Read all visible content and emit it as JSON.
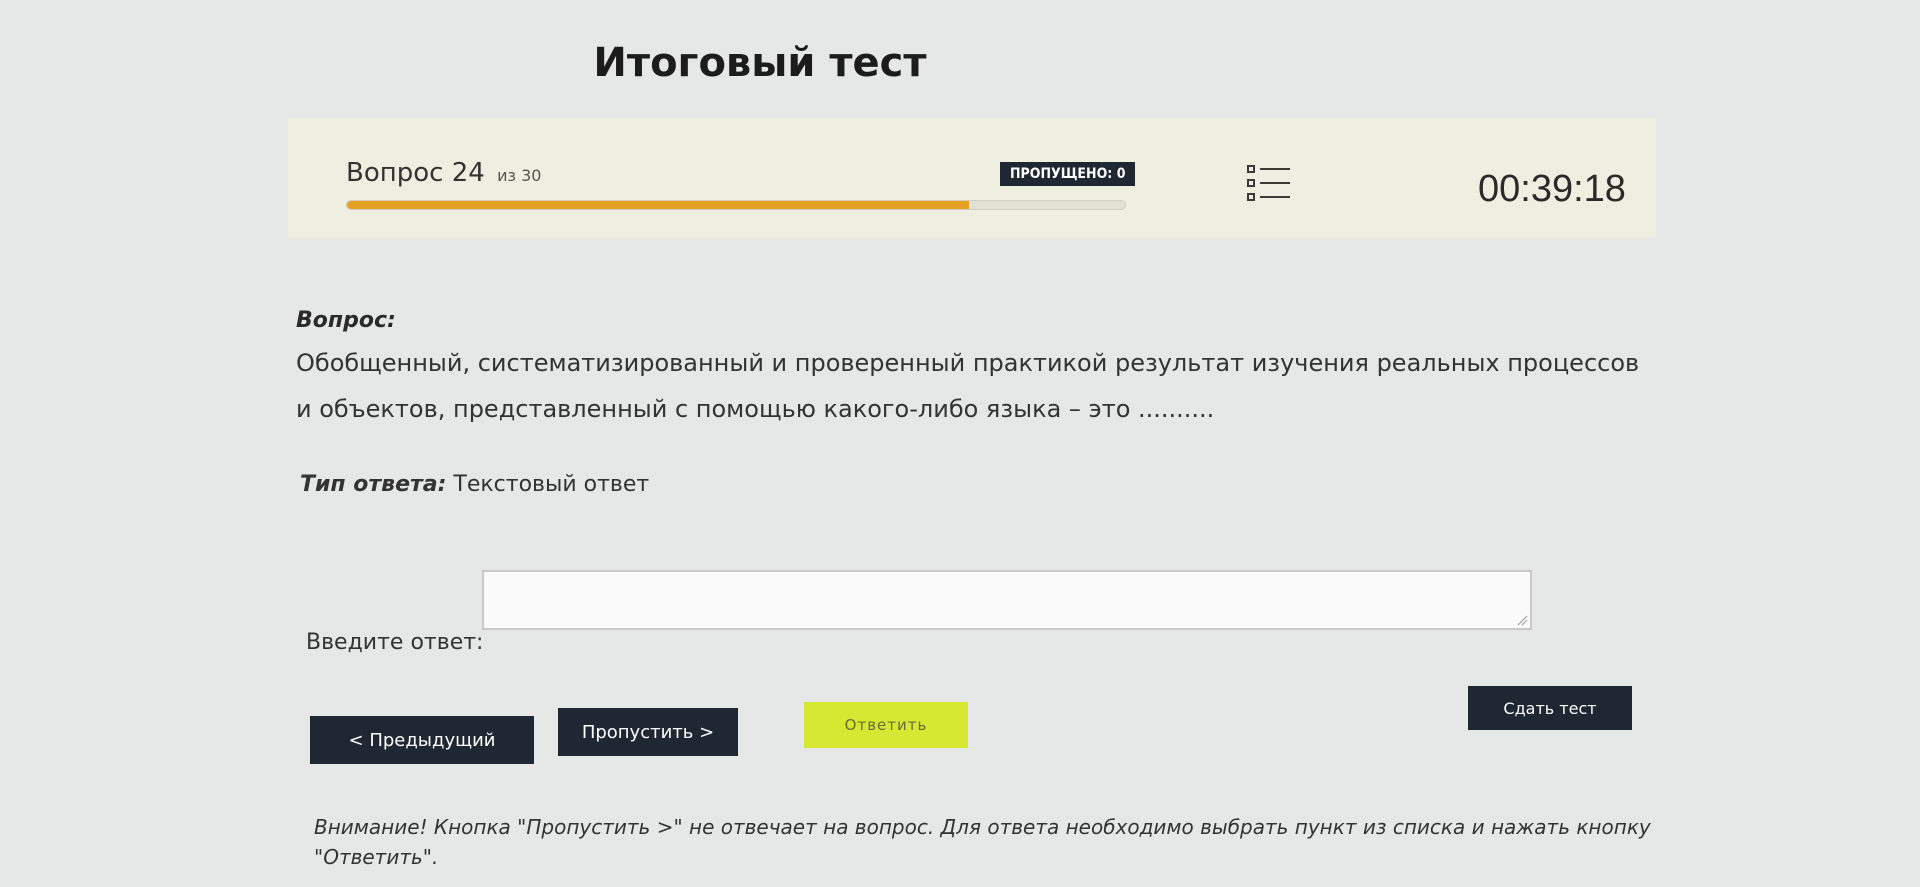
{
  "header": {
    "title": "Итоговый тест"
  },
  "status": {
    "question_label": "Вопрос 24",
    "question_total": "из 30",
    "progress": 0.8,
    "skipped_label": "ПРОПУЩЕНО: 0",
    "timer": "00:39:18"
  },
  "question": {
    "label": "Вопрос:",
    "text": "Обобщенный, систематизированный и проверенный практикой результат изучения реальных процессов и объектов, представленный с помощью какого-либо языка – это ..........",
    "answer_type_key": "Тип ответа:",
    "answer_type_value": "Текстовый ответ"
  },
  "answer": {
    "input_label": "Введите ответ:",
    "value": ""
  },
  "buttons": {
    "prev": "< Предыдущий",
    "skip": "Пропустить >",
    "answer": "Ответить",
    "submit": "Сдать тест"
  },
  "warning": "Внимание! Кнопка \"Пропустить >\" не отвечает на вопрос. Для ответа необходимо выбрать пункт из списка и нажать кнопку \"Ответить\".",
  "colors": {
    "progress": "#e6a024",
    "dark_button": "#1f2733",
    "answer_button": "#d7e832",
    "panel": "#efefe1"
  }
}
